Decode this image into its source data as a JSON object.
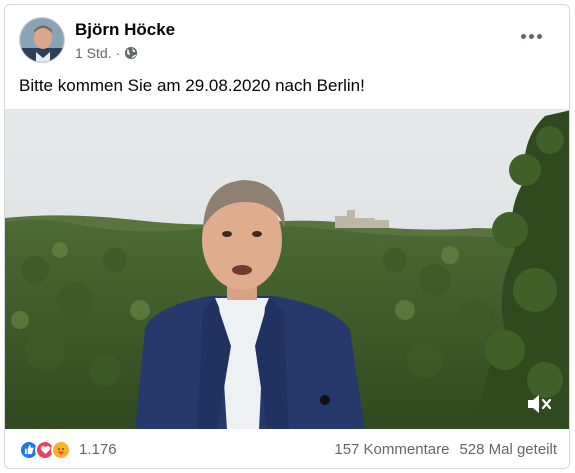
{
  "post": {
    "author": "Björn Höcke",
    "timestamp": "1 Std.",
    "separator": "·",
    "text": "Bitte kommen Sie am 29.08.2020 nach Berlin!"
  },
  "icons": {
    "avatar": "profile-photo",
    "privacy": "globe-icon",
    "more": "more-horizontal-icon",
    "mute": "speaker-muted-icon",
    "reactions": [
      "like-icon",
      "love-icon",
      "care-icon"
    ]
  },
  "colors": {
    "like": "#1877f2",
    "love": "#f33e58",
    "care": "#f7b125",
    "secondary_text": "#65676b"
  },
  "stats": {
    "reaction_count": "1.176",
    "comments": "157 Kommentare",
    "shares": "528 Mal geteilt"
  }
}
